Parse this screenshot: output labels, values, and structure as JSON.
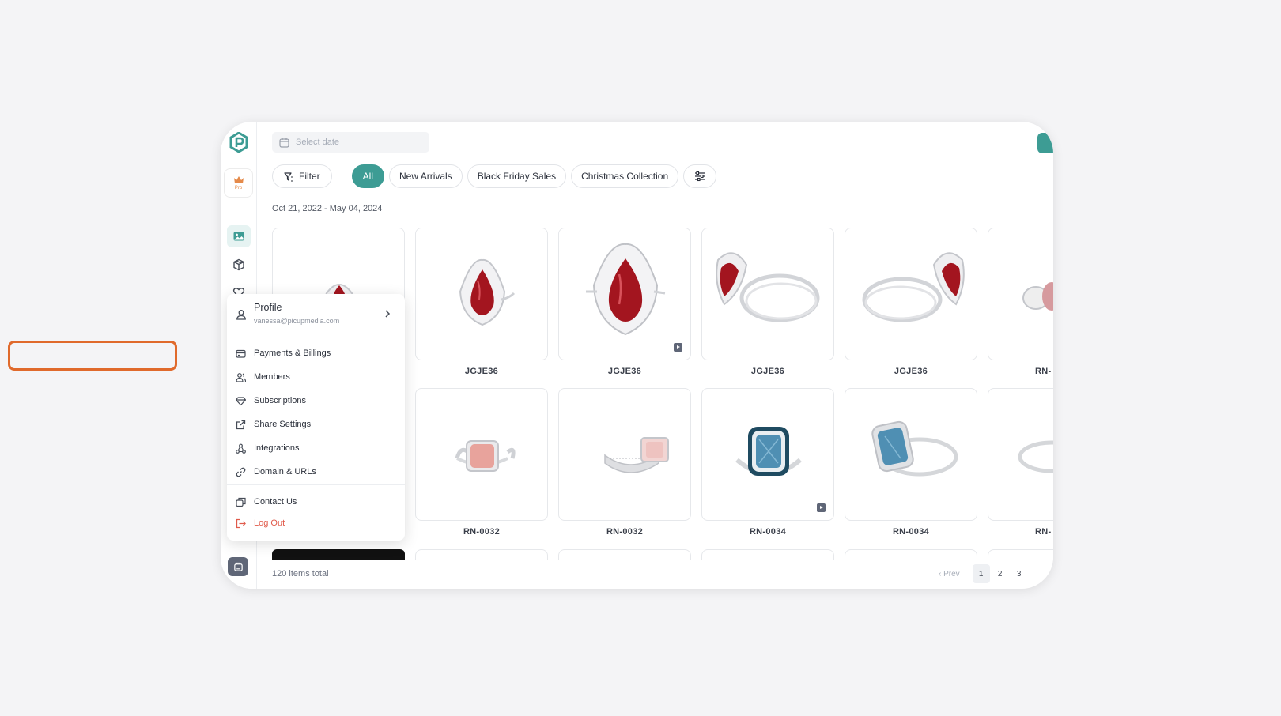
{
  "brand": {
    "accent": "#3d9c94",
    "highlight": "#e06a2c",
    "danger": "#e05a4a"
  },
  "sidebar": {
    "pro_label": "Pro",
    "icons": [
      "logo-icon",
      "crown-icon",
      "image-icon",
      "box-icon",
      "heart-icon",
      "storage-icon"
    ]
  },
  "toolbar": {
    "date_placeholder": "Select date",
    "filter_label": "Filter",
    "chips": [
      "All",
      "New Arrivals",
      "Black Friday Sales",
      "Christmas Collection"
    ],
    "active_chip": "All"
  },
  "date_range": "Oct 21, 2022 - May 04, 2024",
  "grid": {
    "row1": [
      {
        "sku": "",
        "image": "ruby-pear-ring-front",
        "video": false
      },
      {
        "sku": "JGJE36",
        "image": "ruby-pear-ring-front",
        "video": false
      },
      {
        "sku": "JGJE36",
        "image": "ruby-pear-ring-closeup",
        "video": true
      },
      {
        "sku": "JGJE36",
        "image": "ruby-ring-side",
        "video": false
      },
      {
        "sku": "JGJE36",
        "image": "ruby-ring-side-2",
        "video": false
      },
      {
        "sku": "RN-",
        "image": "pink-ring-partial",
        "video": false
      }
    ],
    "row2": [
      {
        "sku": "RN-0032",
        "image": "pink-cushion-ring-front",
        "video": false
      },
      {
        "sku": "RN-0032",
        "image": "pink-cushion-ring-side",
        "video": false
      },
      {
        "sku": "RN-0034",
        "image": "blue-halo-ring-front",
        "video": true
      },
      {
        "sku": "RN-0034",
        "image": "blue-halo-ring-angle",
        "video": false
      },
      {
        "sku": "RN-",
        "image": "ring-partial",
        "video": false
      }
    ]
  },
  "footer": {
    "total": "120 items total",
    "prev": "‹ Prev",
    "pages": [
      "1",
      "2",
      "3"
    ],
    "current_page": "1"
  },
  "menu": {
    "profile_title": "Profile",
    "profile_email": "vanessa@picupmedia.com",
    "items": [
      "Payments & Billings",
      "Members",
      "Subscriptions",
      "Share Settings",
      "Integrations",
      "Domain & URLs"
    ],
    "contact": "Contact Us",
    "logout": "Log Out",
    "highlighted": "Payments & Billings"
  }
}
